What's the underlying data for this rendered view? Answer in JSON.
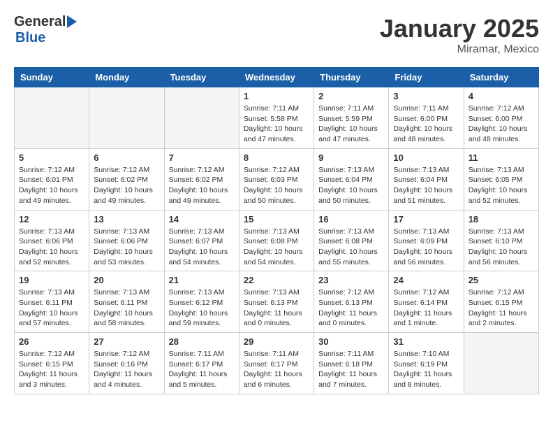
{
  "header": {
    "logo_general": "General",
    "logo_blue": "Blue",
    "month_title": "January 2025",
    "location": "Miramar, Mexico"
  },
  "weekdays": [
    "Sunday",
    "Monday",
    "Tuesday",
    "Wednesday",
    "Thursday",
    "Friday",
    "Saturday"
  ],
  "weeks": [
    [
      {
        "day": "",
        "empty": true
      },
      {
        "day": "",
        "empty": true
      },
      {
        "day": "",
        "empty": true
      },
      {
        "day": "1",
        "sunrise": "7:11 AM",
        "sunset": "5:58 PM",
        "daylight": "10 hours and 47 minutes."
      },
      {
        "day": "2",
        "sunrise": "7:11 AM",
        "sunset": "5:59 PM",
        "daylight": "10 hours and 47 minutes."
      },
      {
        "day": "3",
        "sunrise": "7:11 AM",
        "sunset": "6:00 PM",
        "daylight": "10 hours and 48 minutes."
      },
      {
        "day": "4",
        "sunrise": "7:12 AM",
        "sunset": "6:00 PM",
        "daylight": "10 hours and 48 minutes."
      }
    ],
    [
      {
        "day": "5",
        "sunrise": "7:12 AM",
        "sunset": "6:01 PM",
        "daylight": "10 hours and 49 minutes."
      },
      {
        "day": "6",
        "sunrise": "7:12 AM",
        "sunset": "6:02 PM",
        "daylight": "10 hours and 49 minutes."
      },
      {
        "day": "7",
        "sunrise": "7:12 AM",
        "sunset": "6:02 PM",
        "daylight": "10 hours and 49 minutes."
      },
      {
        "day": "8",
        "sunrise": "7:12 AM",
        "sunset": "6:03 PM",
        "daylight": "10 hours and 50 minutes."
      },
      {
        "day": "9",
        "sunrise": "7:13 AM",
        "sunset": "6:04 PM",
        "daylight": "10 hours and 50 minutes."
      },
      {
        "day": "10",
        "sunrise": "7:13 AM",
        "sunset": "6:04 PM",
        "daylight": "10 hours and 51 minutes."
      },
      {
        "day": "11",
        "sunrise": "7:13 AM",
        "sunset": "6:05 PM",
        "daylight": "10 hours and 52 minutes."
      }
    ],
    [
      {
        "day": "12",
        "sunrise": "7:13 AM",
        "sunset": "6:06 PM",
        "daylight": "10 hours and 52 minutes."
      },
      {
        "day": "13",
        "sunrise": "7:13 AM",
        "sunset": "6:06 PM",
        "daylight": "10 hours and 53 minutes."
      },
      {
        "day": "14",
        "sunrise": "7:13 AM",
        "sunset": "6:07 PM",
        "daylight": "10 hours and 54 minutes."
      },
      {
        "day": "15",
        "sunrise": "7:13 AM",
        "sunset": "6:08 PM",
        "daylight": "10 hours and 54 minutes."
      },
      {
        "day": "16",
        "sunrise": "7:13 AM",
        "sunset": "6:08 PM",
        "daylight": "10 hours and 55 minutes."
      },
      {
        "day": "17",
        "sunrise": "7:13 AM",
        "sunset": "6:09 PM",
        "daylight": "10 hours and 56 minutes."
      },
      {
        "day": "18",
        "sunrise": "7:13 AM",
        "sunset": "6:10 PM",
        "daylight": "10 hours and 56 minutes."
      }
    ],
    [
      {
        "day": "19",
        "sunrise": "7:13 AM",
        "sunset": "6:11 PM",
        "daylight": "10 hours and 57 minutes."
      },
      {
        "day": "20",
        "sunrise": "7:13 AM",
        "sunset": "6:11 PM",
        "daylight": "10 hours and 58 minutes."
      },
      {
        "day": "21",
        "sunrise": "7:13 AM",
        "sunset": "6:12 PM",
        "daylight": "10 hours and 59 minutes."
      },
      {
        "day": "22",
        "sunrise": "7:13 AM",
        "sunset": "6:13 PM",
        "daylight": "11 hours and 0 minutes."
      },
      {
        "day": "23",
        "sunrise": "7:12 AM",
        "sunset": "6:13 PM",
        "daylight": "11 hours and 0 minutes."
      },
      {
        "day": "24",
        "sunrise": "7:12 AM",
        "sunset": "6:14 PM",
        "daylight": "11 hours and 1 minute."
      },
      {
        "day": "25",
        "sunrise": "7:12 AM",
        "sunset": "6:15 PM",
        "daylight": "11 hours and 2 minutes."
      }
    ],
    [
      {
        "day": "26",
        "sunrise": "7:12 AM",
        "sunset": "6:15 PM",
        "daylight": "11 hours and 3 minutes."
      },
      {
        "day": "27",
        "sunrise": "7:12 AM",
        "sunset": "6:16 PM",
        "daylight": "11 hours and 4 minutes."
      },
      {
        "day": "28",
        "sunrise": "7:11 AM",
        "sunset": "6:17 PM",
        "daylight": "11 hours and 5 minutes."
      },
      {
        "day": "29",
        "sunrise": "7:11 AM",
        "sunset": "6:17 PM",
        "daylight": "11 hours and 6 minutes."
      },
      {
        "day": "30",
        "sunrise": "7:11 AM",
        "sunset": "6:18 PM",
        "daylight": "11 hours and 7 minutes."
      },
      {
        "day": "31",
        "sunrise": "7:10 AM",
        "sunset": "6:19 PM",
        "daylight": "11 hours and 8 minutes."
      },
      {
        "day": "",
        "empty": true
      }
    ]
  ]
}
